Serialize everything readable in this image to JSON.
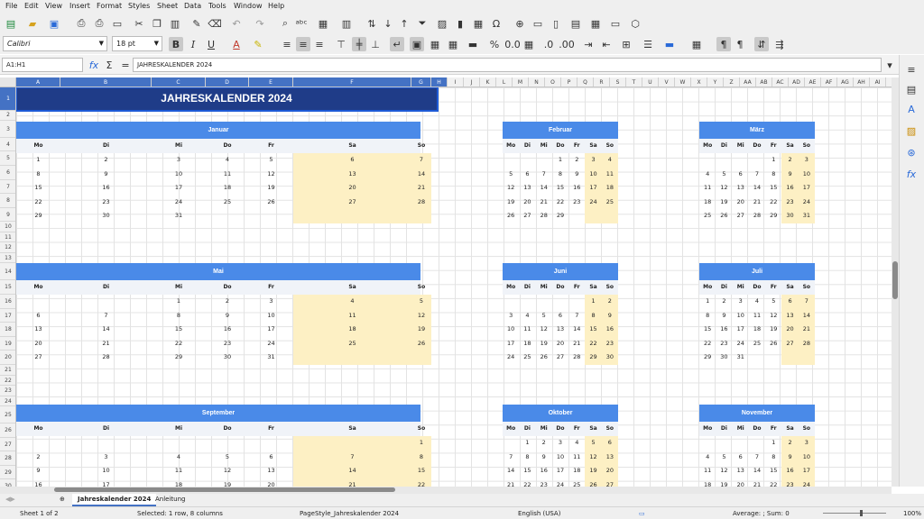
{
  "menu": [
    "File",
    "Edit",
    "View",
    "Insert",
    "Format",
    "Styles",
    "Sheet",
    "Data",
    "Tools",
    "Window",
    "Help"
  ],
  "font_name": "Calibri",
  "font_size": "18 pt",
  "name_box": "A1:H1",
  "formula_content": "JAHRESKALENDER 2024",
  "columns": [
    "A",
    "B",
    "C",
    "D",
    "E",
    "F",
    "G",
    "H",
    "I",
    "J",
    "K",
    "L",
    "M",
    "N",
    "O",
    "P",
    "Q",
    "R",
    "S",
    "T",
    "U",
    "V",
    "W",
    "X",
    "Y",
    "Z",
    "AA",
    "AB",
    "AC",
    "AD",
    "AE",
    "AF",
    "AG",
    "AH",
    "AI"
  ],
  "rows": [
    "1",
    "2",
    "3",
    "4",
    "5",
    "6",
    "7",
    "8",
    "9",
    "10",
    "11",
    "12",
    "13",
    "14",
    "15",
    "16",
    "17",
    "18",
    "19",
    "20",
    "21",
    "22",
    "23",
    "24",
    "25",
    "26",
    "27",
    "28",
    "29",
    "30"
  ],
  "title": "JAHRESKALENDER 2024",
  "weekdays": [
    "Mo",
    "Di",
    "Mi",
    "Do",
    "Fr",
    "Sa",
    "So"
  ],
  "months": [
    {
      "name": "Januar",
      "weeks": [
        [
          "1",
          "2",
          "3",
          "4",
          "5",
          "6",
          "7"
        ],
        [
          "8",
          "9",
          "10",
          "11",
          "12",
          "13",
          "14"
        ],
        [
          "15",
          "16",
          "17",
          "18",
          "19",
          "20",
          "21"
        ],
        [
          "22",
          "23",
          "24",
          "25",
          "26",
          "27",
          "28"
        ],
        [
          "29",
          "30",
          "31",
          "",
          "",
          "",
          ""
        ]
      ]
    },
    {
      "name": "Februar",
      "weeks": [
        [
          "",
          "",
          "",
          "1",
          "2",
          "3",
          "4"
        ],
        [
          "5",
          "6",
          "7",
          "8",
          "9",
          "10",
          "11"
        ],
        [
          "12",
          "13",
          "14",
          "15",
          "16",
          "17",
          "18"
        ],
        [
          "19",
          "20",
          "21",
          "22",
          "23",
          "24",
          "25"
        ],
        [
          "26",
          "27",
          "28",
          "29",
          "",
          "",
          ""
        ]
      ]
    },
    {
      "name": "März",
      "weeks": [
        [
          "",
          "",
          "",
          "",
          "1",
          "2",
          "3"
        ],
        [
          "4",
          "5",
          "6",
          "7",
          "8",
          "9",
          "10"
        ],
        [
          "11",
          "12",
          "13",
          "14",
          "15",
          "16",
          "17"
        ],
        [
          "18",
          "19",
          "20",
          "21",
          "22",
          "23",
          "24"
        ],
        [
          "25",
          "26",
          "27",
          "28",
          "29",
          "30",
          "31"
        ]
      ]
    },
    {
      "name": "Mai",
      "weeks": [
        [
          "",
          "",
          "1",
          "2",
          "3",
          "4",
          "5"
        ],
        [
          "6",
          "7",
          "8",
          "9",
          "10",
          "11",
          "12"
        ],
        [
          "13",
          "14",
          "15",
          "16",
          "17",
          "18",
          "19"
        ],
        [
          "20",
          "21",
          "22",
          "23",
          "24",
          "25",
          "26"
        ],
        [
          "27",
          "28",
          "29",
          "30",
          "31",
          "",
          ""
        ]
      ]
    },
    {
      "name": "Juni",
      "weeks": [
        [
          "",
          "",
          "",
          "",
          "",
          "1",
          "2"
        ],
        [
          "3",
          "4",
          "5",
          "6",
          "7",
          "8",
          "9"
        ],
        [
          "10",
          "11",
          "12",
          "13",
          "14",
          "15",
          "16"
        ],
        [
          "17",
          "18",
          "19",
          "20",
          "21",
          "22",
          "23"
        ],
        [
          "24",
          "25",
          "26",
          "27",
          "28",
          "29",
          "30"
        ]
      ]
    },
    {
      "name": "Juli",
      "weeks": [
        [
          "1",
          "2",
          "3",
          "4",
          "5",
          "6",
          "7"
        ],
        [
          "8",
          "9",
          "10",
          "11",
          "12",
          "13",
          "14"
        ],
        [
          "15",
          "16",
          "17",
          "18",
          "19",
          "20",
          "21"
        ],
        [
          "22",
          "23",
          "24",
          "25",
          "26",
          "27",
          "28"
        ],
        [
          "29",
          "30",
          "31",
          "",
          "",
          "",
          ""
        ]
      ]
    },
    {
      "name": "September",
      "weeks": [
        [
          "",
          "",
          "",
          "",
          "",
          "",
          "1"
        ],
        [
          "2",
          "3",
          "4",
          "5",
          "6",
          "7",
          "8"
        ],
        [
          "9",
          "10",
          "11",
          "12",
          "13",
          "14",
          "15"
        ],
        [
          "16",
          "17",
          "18",
          "19",
          "20",
          "21",
          "22"
        ]
      ]
    },
    {
      "name": "Oktober",
      "weeks": [
        [
          "",
          "1",
          "2",
          "3",
          "4",
          "5",
          "6"
        ],
        [
          "7",
          "8",
          "9",
          "10",
          "11",
          "12",
          "13"
        ],
        [
          "14",
          "15",
          "16",
          "17",
          "18",
          "19",
          "20"
        ],
        [
          "21",
          "22",
          "23",
          "24",
          "25",
          "26",
          "27"
        ]
      ]
    },
    {
      "name": "November",
      "weeks": [
        [
          "",
          "",
          "",
          "",
          "1",
          "2",
          "3"
        ],
        [
          "4",
          "5",
          "6",
          "7",
          "8",
          "9",
          "10"
        ],
        [
          "11",
          "12",
          "13",
          "14",
          "15",
          "16",
          "17"
        ],
        [
          "18",
          "19",
          "20",
          "21",
          "22",
          "23",
          "24"
        ]
      ]
    }
  ],
  "sheet_tabs": [
    "Jahreskalender 2024",
    "Anleitung"
  ],
  "status": {
    "sheet": "Sheet 1 of 2",
    "selection": "Selected: 1 row, 8 columns",
    "page_style": "PageStyle_Jahreskalender 2024",
    "language": "English (USA)",
    "sum": "Average: ; Sum: 0",
    "zoom": "100%"
  },
  "colors": {
    "title_bg": "#1f3c88",
    "month_header": "#4a8ae8",
    "weekend": "#fdf0c4",
    "selection": "#4472c4"
  }
}
